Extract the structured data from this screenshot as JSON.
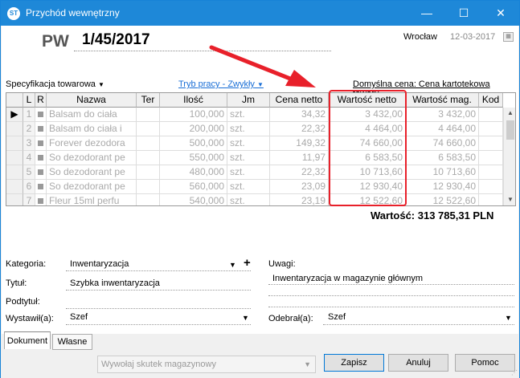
{
  "window": {
    "title": "Przychód wewnętrzny",
    "icon": "ST"
  },
  "header": {
    "doc_type": "PW",
    "doc_number": "1/45/2017",
    "city": "Wrocław",
    "date": "12-03-2017"
  },
  "toolbar": {
    "spec": "Specyfikacja towarowa",
    "tryb": "Tryb pracy - Zwykły",
    "cena": "Domyślna cena: Cena kartotekowa towaru"
  },
  "table": {
    "columns": [
      "L",
      "R",
      "Nazwa",
      "Ter",
      "Ilość",
      "Jm",
      "Cena netto",
      "Wartość netto",
      "Wartość mag.",
      "Kod"
    ],
    "rows": [
      {
        "lp": "1",
        "nazwa": "Balsam do ciała",
        "ilosc": "100,000",
        "jm": "szt.",
        "cena": "34,32",
        "wartosc": "3 432,00",
        "mag": "3 432,00"
      },
      {
        "lp": "2",
        "nazwa": "Balsam do ciała i",
        "ilosc": "200,000",
        "jm": "szt.",
        "cena": "22,32",
        "wartosc": "4 464,00",
        "mag": "4 464,00"
      },
      {
        "lp": "3",
        "nazwa": "Forever dezodora",
        "ilosc": "500,000",
        "jm": "szt.",
        "cena": "149,32",
        "wartosc": "74 660,00",
        "mag": "74 660,00"
      },
      {
        "lp": "4",
        "nazwa": "So dezodorant pe",
        "ilosc": "550,000",
        "jm": "szt.",
        "cena": "11,97",
        "wartosc": "6 583,50",
        "mag": "6 583,50"
      },
      {
        "lp": "5",
        "nazwa": "So dezodorant pe",
        "ilosc": "480,000",
        "jm": "szt.",
        "cena": "22,32",
        "wartosc": "10 713,60",
        "mag": "10 713,60"
      },
      {
        "lp": "6",
        "nazwa": "So dezodorant pe",
        "ilosc": "560,000",
        "jm": "szt.",
        "cena": "23,09",
        "wartosc": "12 930,40",
        "mag": "12 930,40"
      },
      {
        "lp": "7",
        "nazwa": "Fleur 15ml perfu",
        "ilosc": "540,000",
        "jm": "szt.",
        "cena": "23,19",
        "wartosc": "12 522,60",
        "mag": "12 522,60"
      }
    ],
    "total": "Wartość: 313 785,31 PLN"
  },
  "form": {
    "kategoria_label": "Kategoria:",
    "kategoria_value": "Inwentaryzacja",
    "add_symbol": "+",
    "tytul_label": "Tytuł:",
    "tytul_value": "Szybka inwentaryzacja",
    "podtytul_label": "Podtytuł:",
    "wystawil_label": "Wystawił(a):",
    "wystawil_value": "Szef",
    "uwagi_label": "Uwagi:",
    "uwagi_value": "Inwentaryzacja w magazynie głównym",
    "odebral_label": "Odebrał(a):",
    "odebral_value": "Szef"
  },
  "tabs": [
    "Dokument",
    "Własne"
  ],
  "footer": {
    "wywolaj": "Wywołaj skutek magazynowy",
    "zapisz": "Zapisz",
    "anuluj": "Anuluj",
    "pomoc": "Pomoc"
  },
  "colors": {
    "titlebar": "#1e88d8",
    "highlight": "#e8202a",
    "link": "#1a6fd6"
  }
}
